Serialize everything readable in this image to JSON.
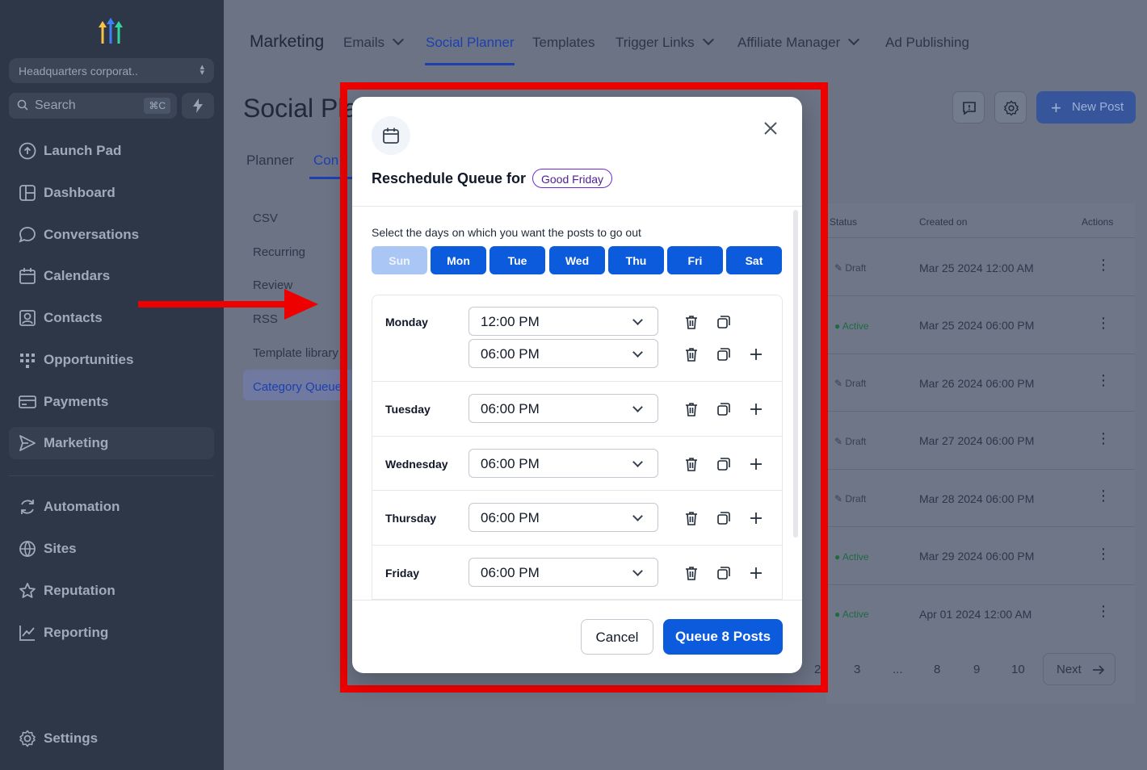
{
  "sidebar": {
    "location": "Headquarters corporat..",
    "search_placeholder": "Search",
    "search_shortcut": "⌘C",
    "items": [
      {
        "label": "Launch Pad",
        "icon": "rocket-icon"
      },
      {
        "label": "Dashboard",
        "icon": "dashboard-icon"
      },
      {
        "label": "Conversations",
        "icon": "chat-icon"
      },
      {
        "label": "Calendars",
        "icon": "calendar-icon"
      },
      {
        "label": "Contacts",
        "icon": "contacts-icon"
      },
      {
        "label": "Opportunities",
        "icon": "opportunities-icon"
      },
      {
        "label": "Payments",
        "icon": "payments-icon"
      },
      {
        "label": "Marketing",
        "icon": "marketing-icon"
      },
      {
        "label": "Automation",
        "icon": "automation-icon"
      },
      {
        "label": "Sites",
        "icon": "globe-icon"
      },
      {
        "label": "Reputation",
        "icon": "star-icon"
      },
      {
        "label": "Reporting",
        "icon": "chart-icon"
      }
    ],
    "settings": "Settings"
  },
  "topnav": {
    "title": "Marketing",
    "items": [
      "Emails",
      "Social Planner",
      "Templates",
      "Trigger Links",
      "Affiliate Manager",
      "Ad Publishing"
    ]
  },
  "page": {
    "title": "Social Pla",
    "tabs": [
      "Planner",
      "Con"
    ],
    "sub_items": [
      "CSV",
      "Recurring",
      "Review",
      "RSS",
      "Template library",
      "Category Queue"
    ],
    "new_post": "New Post",
    "table": {
      "headers": [
        "Status",
        "Created on",
        "Actions"
      ],
      "rows": [
        {
          "status": "Draft",
          "created": "Mar 25 2024 12:00 AM"
        },
        {
          "status": "Active",
          "created": "Mar 25 2024 06:00 PM"
        },
        {
          "status": "Draft",
          "created": "Mar 26 2024 06:00 PM"
        },
        {
          "status": "Draft",
          "created": "Mar 27 2024 06:00 PM"
        },
        {
          "status": "Draft",
          "created": "Mar 28 2024 06:00 PM"
        },
        {
          "status": "Active",
          "created": "Mar 29 2024 06:00 PM"
        },
        {
          "status": "Active",
          "created": "Apr 01 2024 12:00 AM"
        }
      ]
    },
    "pager": {
      "pages": [
        "2",
        "3",
        "...",
        "8",
        "9",
        "10"
      ],
      "next": "Next"
    }
  },
  "modal": {
    "title": "Reschedule Queue for",
    "badge": "Good Friday",
    "help": "Select the days on which you want the posts to go out",
    "days": [
      {
        "label": "Sun",
        "selected": false
      },
      {
        "label": "Mon",
        "selected": true
      },
      {
        "label": "Tue",
        "selected": true
      },
      {
        "label": "Wed",
        "selected": true
      },
      {
        "label": "Thu",
        "selected": true
      },
      {
        "label": "Fri",
        "selected": true
      },
      {
        "label": "Sat",
        "selected": true
      }
    ],
    "schedule": [
      {
        "day": "Monday",
        "times": [
          "12:00 PM",
          "06:00 PM"
        ]
      },
      {
        "day": "Tuesday",
        "times": [
          "06:00 PM"
        ]
      },
      {
        "day": "Wednesday",
        "times": [
          "06:00 PM"
        ]
      },
      {
        "day": "Thursday",
        "times": [
          "06:00 PM"
        ]
      },
      {
        "day": "Friday",
        "times": [
          "06:00 PM"
        ]
      }
    ],
    "cancel": "Cancel",
    "submit": "Queue 8 Posts"
  },
  "colors": {
    "primary": "#0b5bdc",
    "annotation": "#ee0000",
    "sidebar": "#2d3748"
  }
}
